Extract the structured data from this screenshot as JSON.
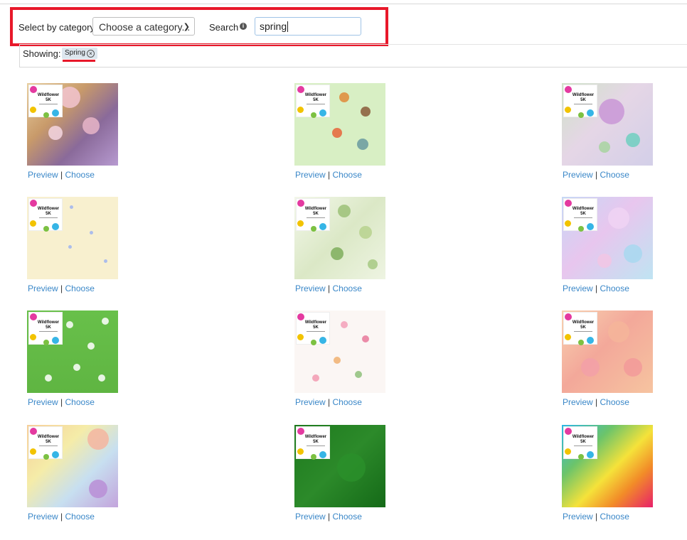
{
  "filter": {
    "category_label": "Select by category:",
    "category_value": "Choose a category...",
    "search_label": "Search",
    "search_value": "spring"
  },
  "showing": {
    "label": "Showing:",
    "tag": "Spring"
  },
  "link_labels": {
    "preview": "Preview",
    "separator": "|",
    "choose": "Choose"
  },
  "logo": {
    "line1": "Wildflower",
    "line2": "5K"
  },
  "tiles": [
    {
      "pattern": "blossom-branches",
      "bg": "linear-gradient(135deg,#e8cfa0 0%,#c89a6a 35%,#8a6a9a 65%,#b79ad0 100%)"
    },
    {
      "pattern": "garden-tools",
      "bg": "linear-gradient(#d8efc4,#d8efc4)"
    },
    {
      "pattern": "pastel-flowers",
      "bg": "linear-gradient(135deg,#cfe3c8 0%,#e5d6e6 45%,#d3cfe8 100%)"
    },
    {
      "pattern": "blue-dot-flowers",
      "bg": "linear-gradient(#f8f0cf,#f8f0cf)"
    },
    {
      "pattern": "green-leaves",
      "bg": "linear-gradient(135deg,#f3f7ea 0%,#dbe8c6 50%,#eef4e2 100%)"
    },
    {
      "pattern": "watercolor-butterflies",
      "bg": "linear-gradient(135deg,#c6d8f5 0%,#e8c6ee 45%,#bfe4f2 100%)"
    },
    {
      "pattern": "white-daisies",
      "bg": "linear-gradient(#68c04a,#5fb542)"
    },
    {
      "pattern": "tulip-floral",
      "bg": "linear-gradient(#fbf6f4,#fbf6f4)"
    },
    {
      "pattern": "peach-bokeh",
      "bg": "linear-gradient(135deg,#f8d2b0 0%,#f3a89a 45%,#f6c4a0 100%)"
    },
    {
      "pattern": "pastel-rainbow",
      "bg": "linear-gradient(135deg,#f6ce9a 0%,#f5eca8 35%,#c7dff0 65%,#c3a4dc 100%)"
    },
    {
      "pattern": "green-texture",
      "bg": "linear-gradient(135deg,#1e7a1e 0%,#2c8a2a 50%,#156a18 100%)"
    },
    {
      "pattern": "rainbow-gradient",
      "bg": "linear-gradient(135deg,#2bb7e6 0%,#6cc46a 30%,#f5e23a 55%,#f28c28 75%,#e8206a 100%)"
    }
  ]
}
